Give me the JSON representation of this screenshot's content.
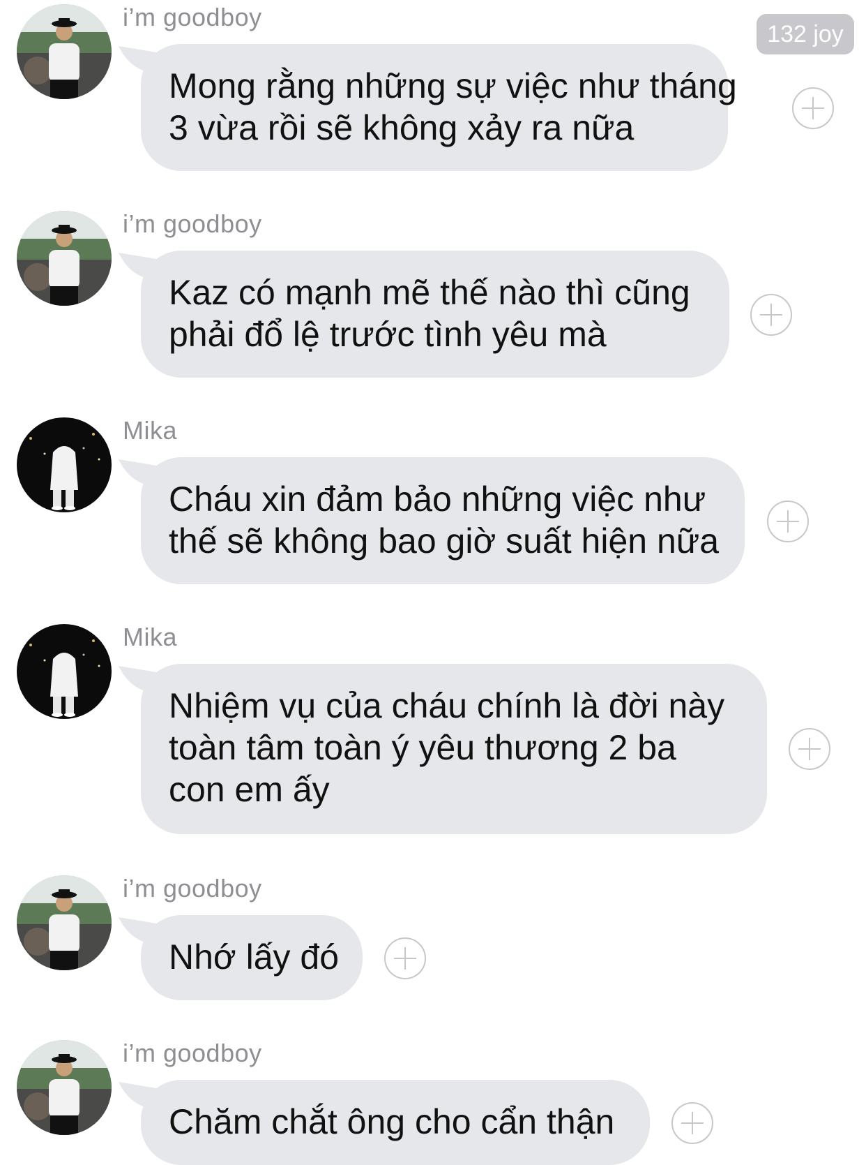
{
  "joy_badge": "132 joy",
  "messages": [
    {
      "sender": "i’m goodboy",
      "avatar": "goodboy-avatar",
      "lines": [
        "Mong rằng những sự việc như tháng",
        "3 vừa rồi sẽ không xảy ra nữa"
      ]
    },
    {
      "sender": "i’m goodboy",
      "avatar": "goodboy-avatar",
      "lines": [
        "Kaz có mạnh mẽ thế nào thì cũng",
        "phải đổ lệ trước tình yêu mà"
      ]
    },
    {
      "sender": "Mika",
      "avatar": "mika-avatar",
      "lines": [
        "Cháu xin đảm bảo những việc như",
        "thế sẽ không bao giờ suất hiện nữa"
      ]
    },
    {
      "sender": "Mika",
      "avatar": "mika-avatar",
      "lines": [
        "Nhiệm vụ của cháu chính là  đời này",
        "toàn tâm toàn ý yêu thương 2 ba",
        "con em ấy"
      ]
    },
    {
      "sender": "i’m goodboy",
      "avatar": "goodboy-avatar",
      "lines": [
        "Nhớ lấy đó"
      ]
    },
    {
      "sender": "i’m goodboy",
      "avatar": "goodboy-avatar",
      "lines": [
        "Chăm chắt ông cho cẩn thận"
      ]
    }
  ],
  "colors": {
    "bubble": "#e5e7ea",
    "sender_text": "#8e8e93",
    "message_text": "#111111",
    "add_button": "#c7c7cc",
    "joy_badge_bg": "#c7c7cc"
  },
  "icons": {
    "add_reaction": "plus-circle-icon"
  }
}
